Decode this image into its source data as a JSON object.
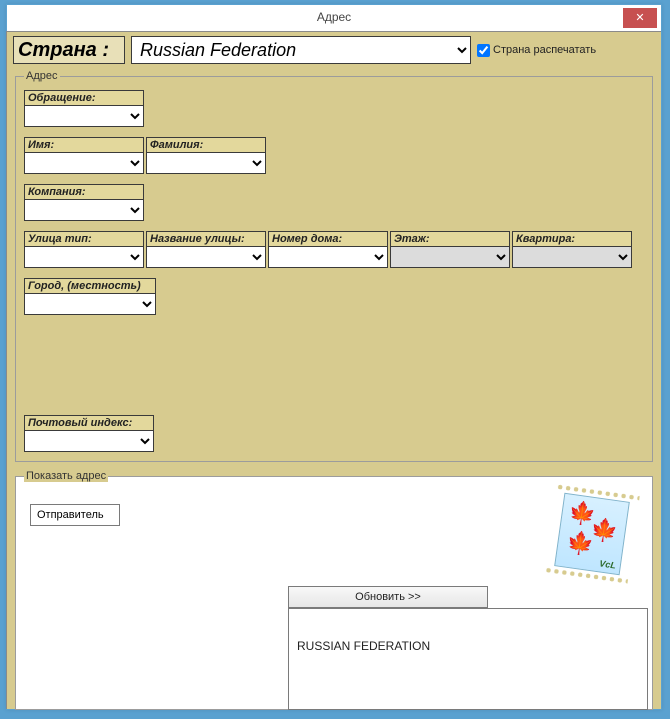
{
  "window": {
    "title": "Адрес"
  },
  "country": {
    "label": "Страна :",
    "value": "Russian Federation",
    "print_checkbox_label": "Страна распечатать",
    "print_checked": true
  },
  "address_fieldset_legend": "Адрес",
  "fields": {
    "salutation": {
      "label": "Обращение:",
      "value": ""
    },
    "first_name": {
      "label": "Имя:",
      "value": ""
    },
    "last_name": {
      "label": "Фамилия:",
      "value": ""
    },
    "company": {
      "label": "Компания:",
      "value": ""
    },
    "street_type": {
      "label": "Улица тип:",
      "value": ""
    },
    "street_name": {
      "label": "Название улицы:",
      "value": ""
    },
    "house_no": {
      "label": "Номер дома:",
      "value": ""
    },
    "floor": {
      "label": "Этаж:",
      "value": ""
    },
    "apartment": {
      "label": "Квартира:",
      "value": ""
    },
    "city": {
      "label": "Город, (местность)",
      "value": ""
    },
    "postal": {
      "label": "Почтовый индекс:",
      "value": ""
    }
  },
  "show_fieldset_legend": "Показать адрес",
  "sender_label": "Отправитель",
  "stamp_label": "VcL",
  "refresh_button": "Обновить >>",
  "preview_text": "RUSSIAN FEDERATION"
}
